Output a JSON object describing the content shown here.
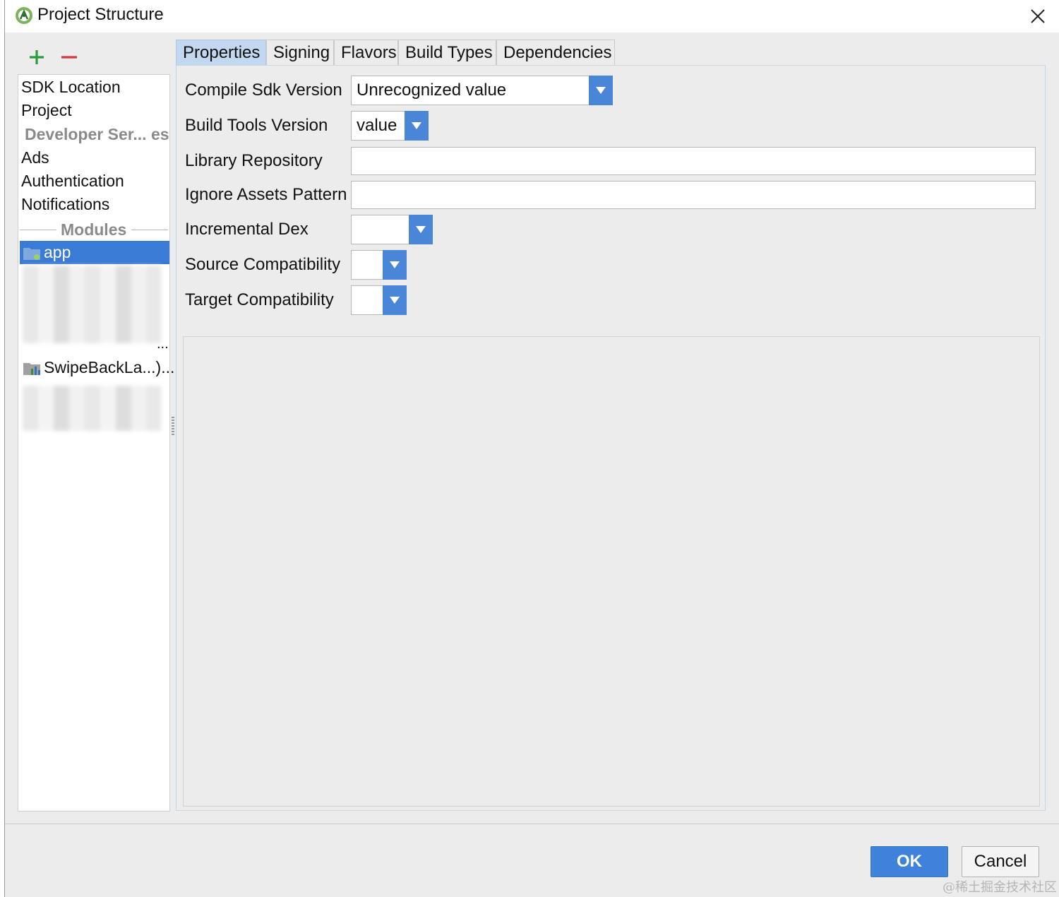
{
  "window": {
    "title": "Project Structure"
  },
  "toolbar": {
    "add_icon": "plus-icon",
    "remove_icon": "minus-icon",
    "accent_add": "#2a9d3a",
    "accent_remove": "#d23b3b"
  },
  "sidebar": {
    "items": [
      "SDK Location",
      "Project"
    ],
    "developer_services_header": "Developer Ser... es",
    "services": [
      "Ads",
      "Authentication",
      "Notifications"
    ],
    "modules_header": "Modules",
    "modules": [
      "app",
      "SwipeBackLa...)..."
    ],
    "truncated_item": "..."
  },
  "tabs": [
    "Properties",
    "Signing",
    "Flavors",
    "Build Types",
    "Dependencies"
  ],
  "active_tab": "Properties",
  "form": {
    "compile_sdk_label": "Compile Sdk Version",
    "compile_sdk_value": "Unrecognized value",
    "build_tools_label": "Build Tools Version",
    "build_tools_value": "value",
    "library_repository_label": "Library Repository",
    "library_repository_value": "",
    "ignore_assets_label": "Ignore Assets Pattern",
    "ignore_assets_value": "",
    "incremental_dex_label": "Incremental Dex",
    "incremental_dex_value": "",
    "source_compat_label": "Source Compatibility",
    "source_compat_value": "",
    "target_compat_label": "Target Compatibility",
    "target_compat_value": ""
  },
  "buttons": {
    "ok": "OK",
    "cancel": "Cancel"
  },
  "watermark": "@稀土掘金技术社区",
  "colors": {
    "accent": "#3a7bd5",
    "selection": "#3a7bd5",
    "tab_active": "#c2d7f0"
  }
}
